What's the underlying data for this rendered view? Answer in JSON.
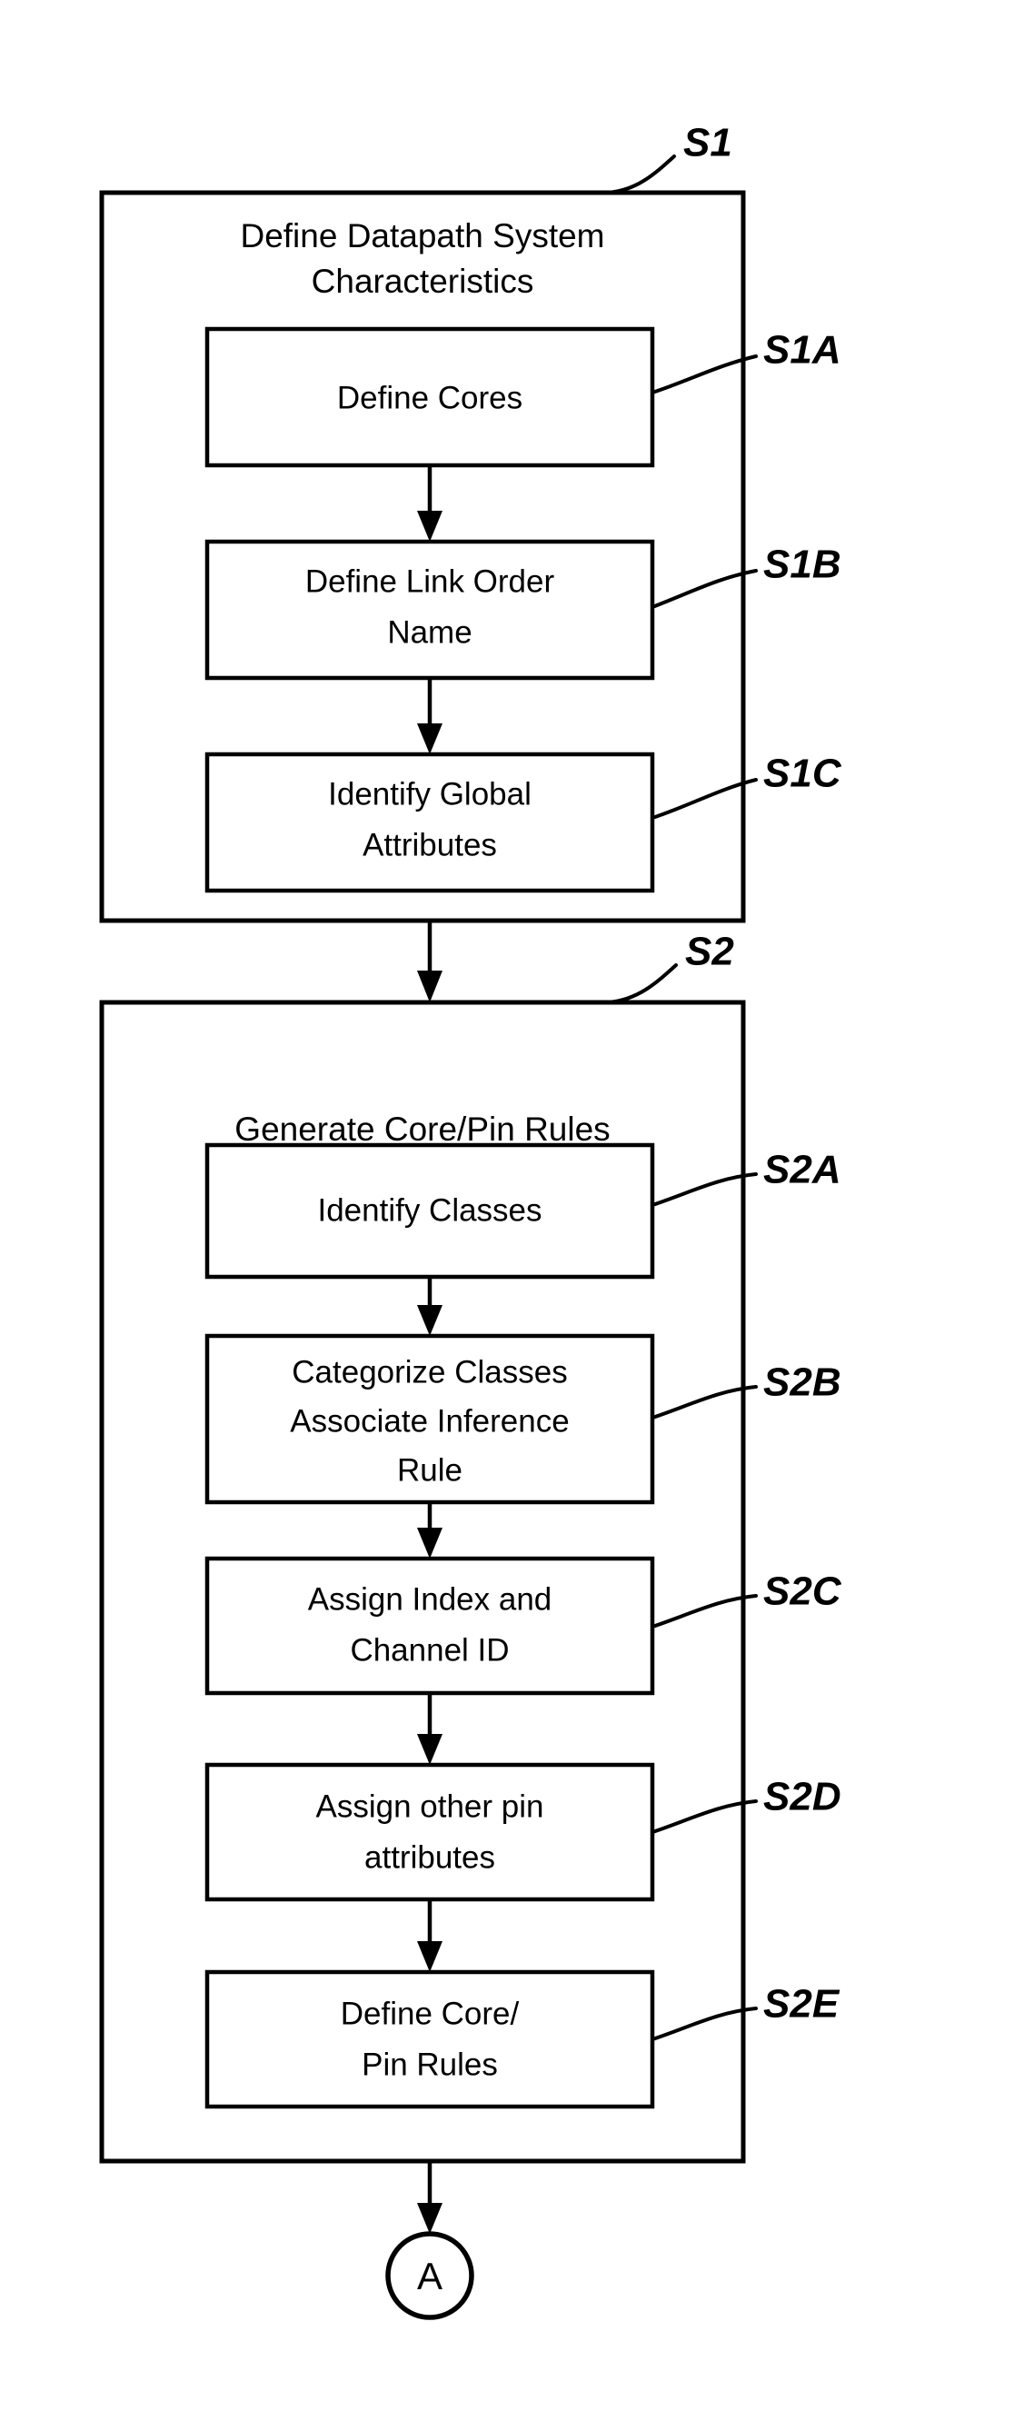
{
  "figure": {
    "type": "flowchart",
    "orientation": "vertical",
    "background_color": "#ffffff",
    "line_color": "#000000"
  },
  "stages": [
    {
      "id": "S1",
      "title": "Define Datapath System Characteristics",
      "title_line1": "Define Datapath System",
      "title_line2": "Characteristics",
      "ref_label": "S1",
      "steps": [
        {
          "id": "S1A",
          "ref_label": "S1A",
          "line1": "Define Cores",
          "line2": ""
        },
        {
          "id": "S1B",
          "ref_label": "S1B",
          "line1": "Define Link Order",
          "line2": "Name"
        },
        {
          "id": "S1C",
          "ref_label": "S1C",
          "line1": "Identify Global",
          "line2": "Attributes"
        }
      ]
    },
    {
      "id": "S2",
      "title": "Generate Core/Pin Rules",
      "title_line1": "Generate Core/Pin Rules",
      "title_line2": "",
      "ref_label": "S2",
      "steps": [
        {
          "id": "S2A",
          "ref_label": "S2A",
          "line1": "Identify Classes",
          "line2": "",
          "line3": ""
        },
        {
          "id": "S2B",
          "ref_label": "S2B",
          "line1": "Categorize Classes",
          "line2": "Associate Inference",
          "line3": "Rule"
        },
        {
          "id": "S2C",
          "ref_label": "S2C",
          "line1": "Assign Index and",
          "line2": "Channel ID",
          "line3": ""
        },
        {
          "id": "S2D",
          "ref_label": "S2D",
          "line1": "Assign other pin",
          "line2": "attributes",
          "line3": ""
        },
        {
          "id": "S2E",
          "ref_label": "S2E",
          "line1": "Define Core/",
          "line2": "Pin Rules",
          "line3": ""
        }
      ]
    }
  ],
  "terminal": {
    "id": "connector-A",
    "label": "A",
    "shape": "circle"
  }
}
